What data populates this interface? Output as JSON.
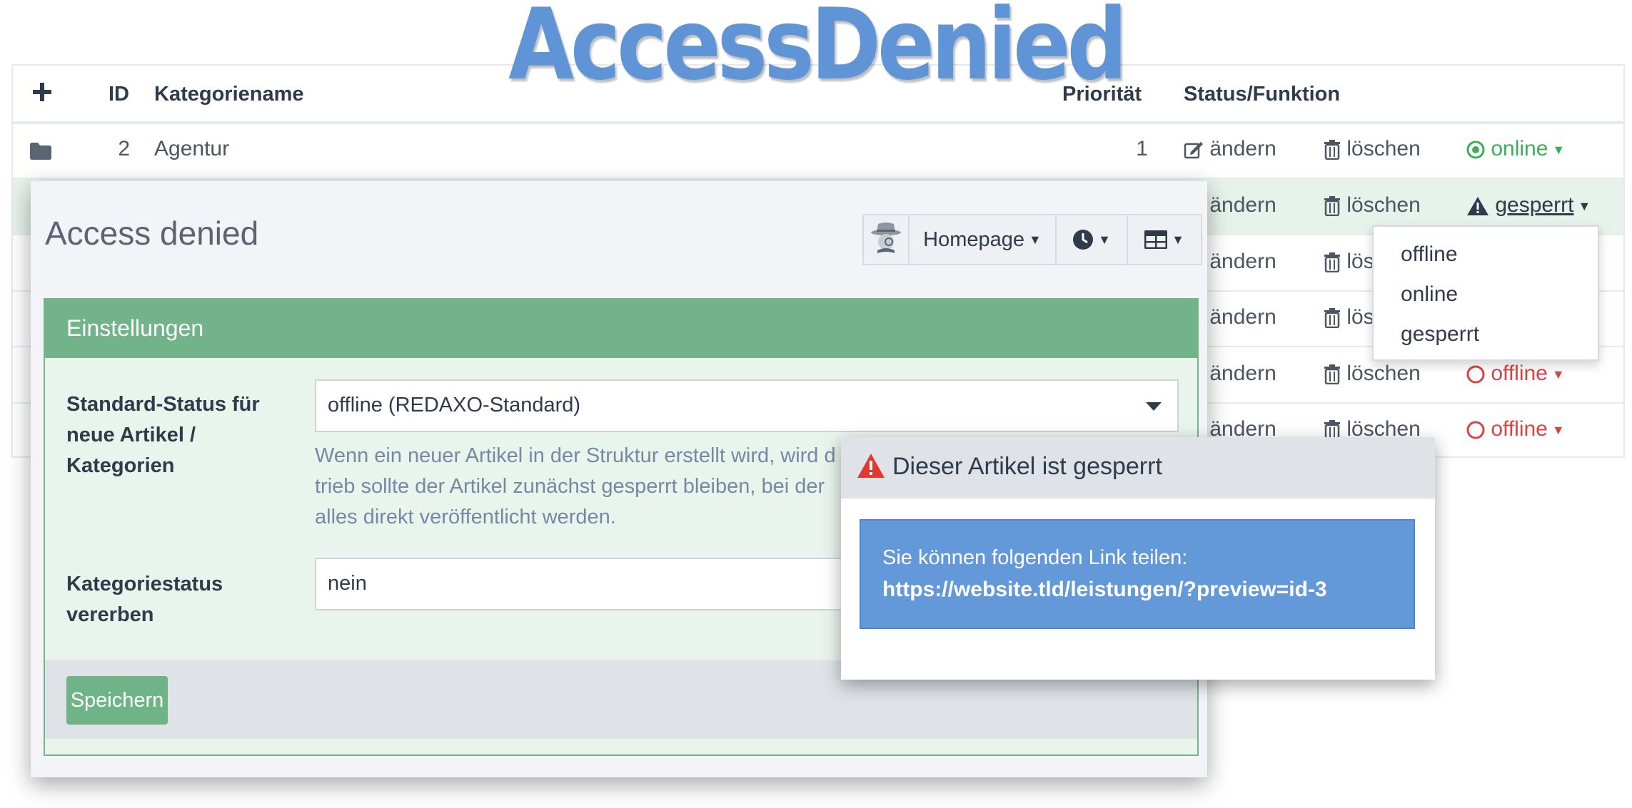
{
  "logo": "AccessDenied",
  "table": {
    "headers": {
      "id": "ID",
      "name": "Kategoriename",
      "priority": "Priorität",
      "status": "Status/Funktion"
    },
    "rows": [
      {
        "id": "2",
        "name": "Agentur",
        "priority": "1",
        "edit": "ändern",
        "delete": "löschen",
        "status": "online"
      },
      {
        "edit": "ändern",
        "delete": "löschen",
        "status": "gesperrt"
      },
      {
        "edit": "ändern",
        "delete": "lös"
      },
      {
        "edit": "ändern",
        "delete": "lös"
      },
      {
        "edit": "ändern",
        "delete": "löschen",
        "status": "offline"
      },
      {
        "edit": "ändern",
        "delete": "löschen",
        "status": "offline"
      }
    ]
  },
  "status_dropdown": {
    "options": [
      "offline",
      "online",
      "gesperrt"
    ]
  },
  "panel": {
    "title": "Access denied",
    "toolbar": {
      "homepage": "Homepage"
    },
    "settings": {
      "heading": "Einstellungen",
      "default_status_label": [
        "Standard-Status für",
        "neue Artikel /",
        "Kategorien"
      ],
      "default_status_value": "offline (REDAXO-Standard)",
      "help_lines": [
        "Wenn ein neuer Artikel in der Struktur erstellt wird, wird d",
        "trieb sollte der Artikel zunächst gesperrt bleiben, bei der",
        "alles direkt veröffentlicht werden."
      ],
      "inherit_label": [
        "Kategoriestatus",
        "vererben"
      ],
      "inherit_value": "nein",
      "save_label": "Speichern"
    }
  },
  "popup": {
    "title": "Dieser Artikel ist gesperrt",
    "share_text": "Sie können folgenden Link teilen:",
    "link": "https://website.tld/leistungen/?preview=id-3"
  },
  "colors": {
    "online": "#3cae5c",
    "offline": "#d64545",
    "settings_green": "#72b38a",
    "alert_blue": "#6399d8",
    "logo_blue": "#5f95d7"
  }
}
